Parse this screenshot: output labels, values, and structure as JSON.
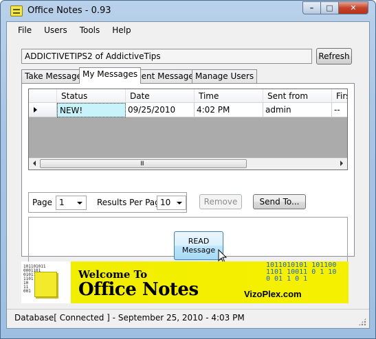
{
  "window": {
    "title": "Office Notes - 0.93"
  },
  "menu": [
    "File",
    "Users",
    "Tools",
    "Help"
  ],
  "user_box": {
    "value": "ADDICTIVETIPS2 of AddictiveTips"
  },
  "refresh_label": "Refresh",
  "tabs": [
    {
      "label": "Take Message",
      "active": false
    },
    {
      "label": "My Messages",
      "active": true
    },
    {
      "label": "Sent Messages",
      "active": false
    },
    {
      "label": "Manage Users",
      "active": false
    }
  ],
  "grid": {
    "columns": [
      "Status",
      "Date",
      "Time",
      "Sent from",
      "Firs"
    ],
    "rows": [
      {
        "status": "NEW!",
        "date": "09/25/2010",
        "time": "4:02 PM",
        "sent_from": "admin",
        "first": "--"
      }
    ],
    "scroll_grip": "III"
  },
  "paging": {
    "page_label": "Page",
    "page_value": "1",
    "results_label": "Results Per Page",
    "results_value": "10"
  },
  "buttons": {
    "remove": "Remove",
    "send_to": "Send To...",
    "read_line1": "READ",
    "read_line2": "Message"
  },
  "banner": {
    "welcome": "Welcome To",
    "title": "Office Notes",
    "site": "VizoPlex.com",
    "binary_left": "101101011\n0001101\n01011010\n1101\n10\n11\n001",
    "binary_right": "1011010101 101100\n1101 10011 0 1 10\n0 01 1 0 1"
  },
  "status": {
    "text": "Database[ Connected ] - September 25, 2010 - 4:03 PM"
  },
  "colors": {
    "titlebar": "#b9d1ea",
    "selected_cell": "#c9f3fb",
    "banner_yellow": "#f5f000",
    "read_button": "#bee6fd"
  }
}
